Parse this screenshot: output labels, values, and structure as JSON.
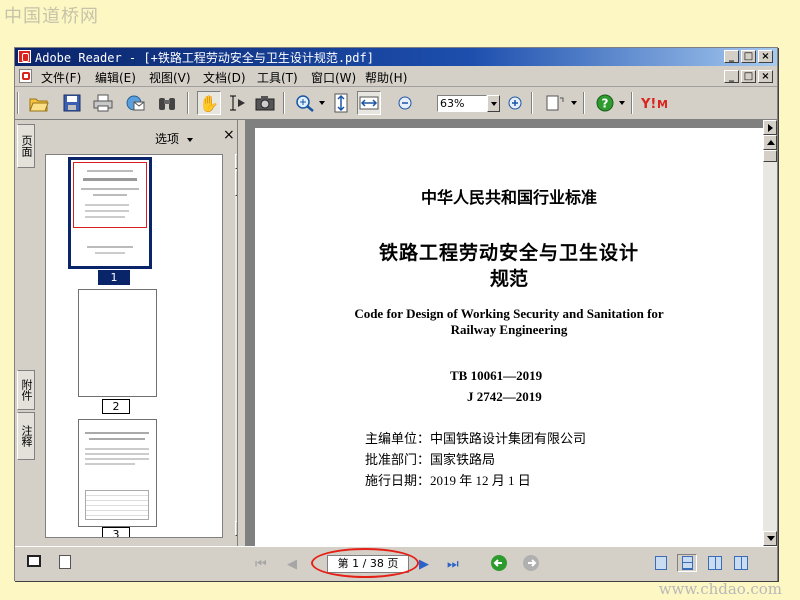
{
  "watermark_top": "中国道桥网",
  "watermark_bottom": "www.chdao.com",
  "window": {
    "title": "Adobe Reader - [+铁路工程劳动安全与卫生设计规范.pdf]",
    "min_label": "_",
    "max_label": "□",
    "close_label": "×"
  },
  "menu": [
    "文件(F)",
    "编辑(E)",
    "视图(V)",
    "文档(D)",
    "工具(T)",
    "窗口(W)",
    "帮助(H)"
  ],
  "toolbar": {
    "zoom_value": "63%"
  },
  "left_tabs": {
    "pages": "页面",
    "attachments": "附件",
    "comments": "注释"
  },
  "nav_panel": {
    "options_label": "选项",
    "close_label": "×",
    "thumbnails": [
      {
        "label": "1",
        "selected": true
      },
      {
        "label": "2",
        "selected": false
      },
      {
        "label": "3",
        "selected": false
      }
    ]
  },
  "document": {
    "header": "中华人民共和国行业标准",
    "title_line1": "铁路工程劳动安全与卫生设计",
    "title_line2": "规范",
    "english_line1": "Code for Design of Working Security and Sanitation for",
    "english_line2": "Railway Engineering",
    "code1": "TB 10061—2019",
    "code2": "J 2742—2019",
    "meta": [
      "主编单位：中国铁路设计集团有限公司",
      "批准部门：国家铁路局",
      "施行日期：2019 年 12 月 1 日"
    ]
  },
  "status": {
    "page_indicator": "第 1 / 38 页"
  }
}
